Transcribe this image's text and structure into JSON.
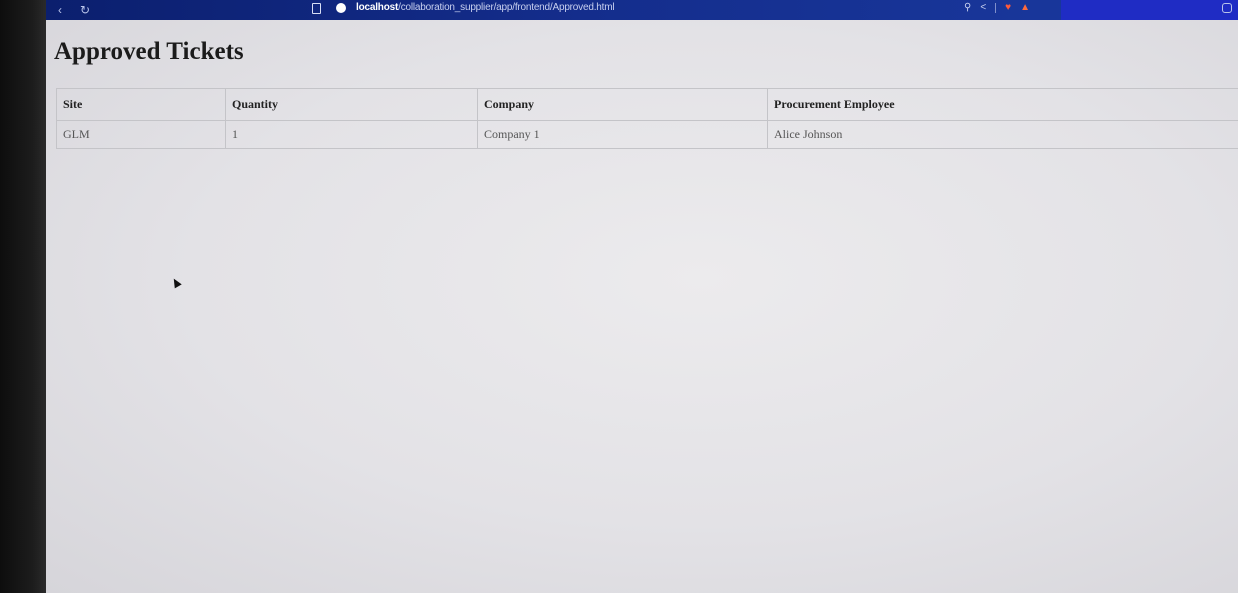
{
  "browser": {
    "nav_back": "‹",
    "nav_reload": "↻",
    "url_host": "localhost",
    "url_path": "/collaboration_supplier/app/frontend/Approved.html"
  },
  "page": {
    "title": "Approved Tickets"
  },
  "table": {
    "headers": [
      "Site",
      "Quantity",
      "Company",
      "Procurement Employee"
    ],
    "rows": [
      [
        "GLM",
        "1",
        "Company 1",
        "Alice Johnson"
      ]
    ]
  }
}
